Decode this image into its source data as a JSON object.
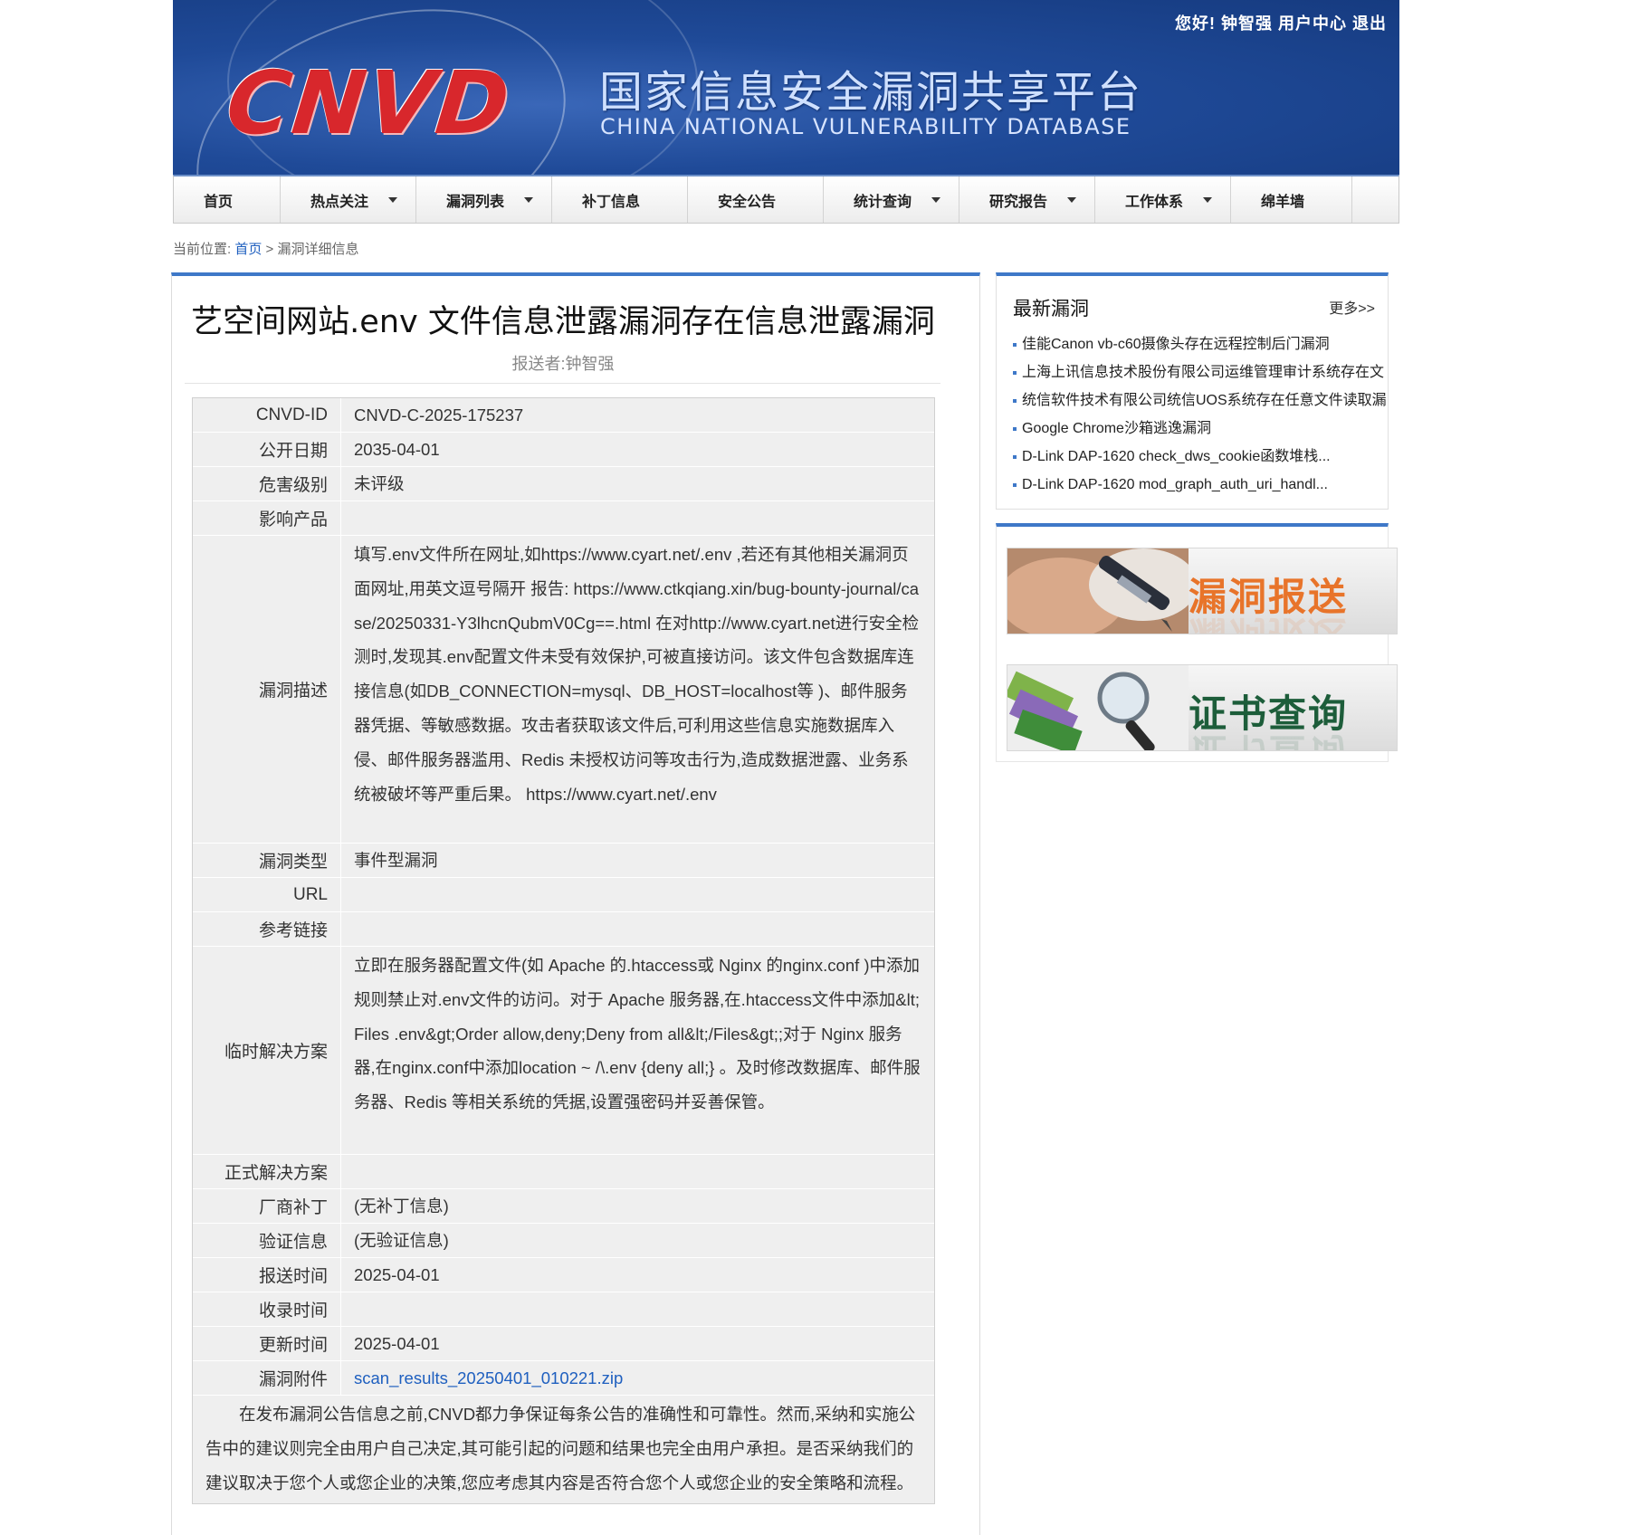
{
  "header": {
    "logo_text": "CNVD",
    "cn_title": "国家信息安全漏洞共享平台",
    "en_title": "CHINA NATIONAL VULNERABILITY DATABASE",
    "greeting": "您好!",
    "username": "钟智强",
    "user_center": "用户中心",
    "logout": "退出"
  },
  "nav": {
    "items": [
      {
        "label": "首页",
        "dropdown": false
      },
      {
        "label": "热点关注",
        "dropdown": true
      },
      {
        "label": "漏洞列表",
        "dropdown": true
      },
      {
        "label": "补丁信息",
        "dropdown": false
      },
      {
        "label": "安全公告",
        "dropdown": false
      },
      {
        "label": "统计查询",
        "dropdown": true
      },
      {
        "label": "研究报告",
        "dropdown": true
      },
      {
        "label": "工作体系",
        "dropdown": true
      },
      {
        "label": "绵羊墙",
        "dropdown": false
      }
    ]
  },
  "breadcrumb": {
    "prefix": "当前位置:",
    "home": "首页",
    "current": "> 漏洞详细信息"
  },
  "detail": {
    "title": "艺空间网站.env 文件信息泄露漏洞存在信息泄露漏洞",
    "reporter": "报送者:钟智强",
    "rows": [
      {
        "key": "CNVD-ID",
        "value": "CNVD-C-2025-175237"
      },
      {
        "key": "公开日期",
        "value": "2035-04-01"
      },
      {
        "key": "危害级别",
        "value": "未评级"
      },
      {
        "key": "影响产品",
        "value": ""
      },
      {
        "key": "漏洞描述",
        "value": "填写.env文件所在网址,如https://www.cyart.net/.env ,若还有其他相关漏洞页面网址,用英文逗号隔开 报告: https://www.ctkqiang.xin/bug-bounty-journal/case/20250331-Y3lhcnQubmV0Cg==.html 在对http://www.cyart.net进行安全检测时,发现其.env配置文件未受有效保护,可被直接访问。该文件包含数据库连接信息(如DB_CONNECTION=mysql、DB_HOST=localhost等 )、邮件服务器凭据、等敏感数据。攻击者获取该文件后,可利用这些信息实施数据库入侵、邮件服务器滥用、Redis 未授权访问等攻击行为,造成数据泄露、业务系统被破坏等严重后果。 https://www.cyart.net/.env"
      },
      {
        "key": "漏洞类型",
        "value": "事件型漏洞"
      },
      {
        "key": "URL",
        "value": ""
      },
      {
        "key": "参考链接",
        "value": ""
      },
      {
        "key": "临时解决方案",
        "value": "立即在服务器配置文件(如 Apache 的.htaccess或 Nginx 的nginx.conf )中添加规则禁止对.env文件的访问。对于 Apache 服务器,在.htaccess文件中添加&lt;Files .env&gt;Order allow,deny;Deny from all&lt;/Files&gt;;对于 Nginx 服务器,在nginx.conf中添加location ~ /\\.env {deny all;} 。及时修改数据库、邮件服务器、Redis 等相关系统的凭据,设置强密码并妥善保管。"
      },
      {
        "key": "正式解决方案",
        "value": ""
      },
      {
        "key": "厂商补丁",
        "value": "(无补丁信息)"
      },
      {
        "key": "验证信息",
        "value": "(无验证信息)"
      },
      {
        "key": "报送时间",
        "value": "2025-04-01"
      },
      {
        "key": "收录时间",
        "value": ""
      },
      {
        "key": "更新时间",
        "value": "2025-04-01"
      },
      {
        "key": "漏洞附件",
        "value": "scan_results_20250401_010221.zip"
      }
    ],
    "disclaimer": "在发布漏洞公告信息之前,CNVD都力争保证每条公告的准确性和可靠性。然而,采纳和实施公告中的建议则完全由用户自己决定,其可能引起的问题和结果也完全由用户承担。是否采纳我们的建议取决于您个人或您企业的决策,您应考虑其内容是否符合您个人或您企业的安全策略和流程。"
  },
  "sidebar": {
    "title": "最新漏洞",
    "more": "更多>>",
    "items": [
      "佳能Canon vb-c60摄像头存在远程控制后门漏洞",
      "上海上讯信息技术股份有限公司运维管理审计系统存在文",
      "统信软件技术有限公司统信UOS系统存在任意文件读取漏",
      "Google Chrome沙箱逃逸漏洞",
      "D-Link DAP-1620 check_dws_cookie函数堆栈...",
      "D-Link DAP-1620 mod_graph_auth_uri_handl..."
    ],
    "promo_report": "漏洞报送",
    "promo_cert": "证书查询",
    "colors": {
      "report": "#e8742a",
      "cert": "#1d5d3a"
    }
  }
}
